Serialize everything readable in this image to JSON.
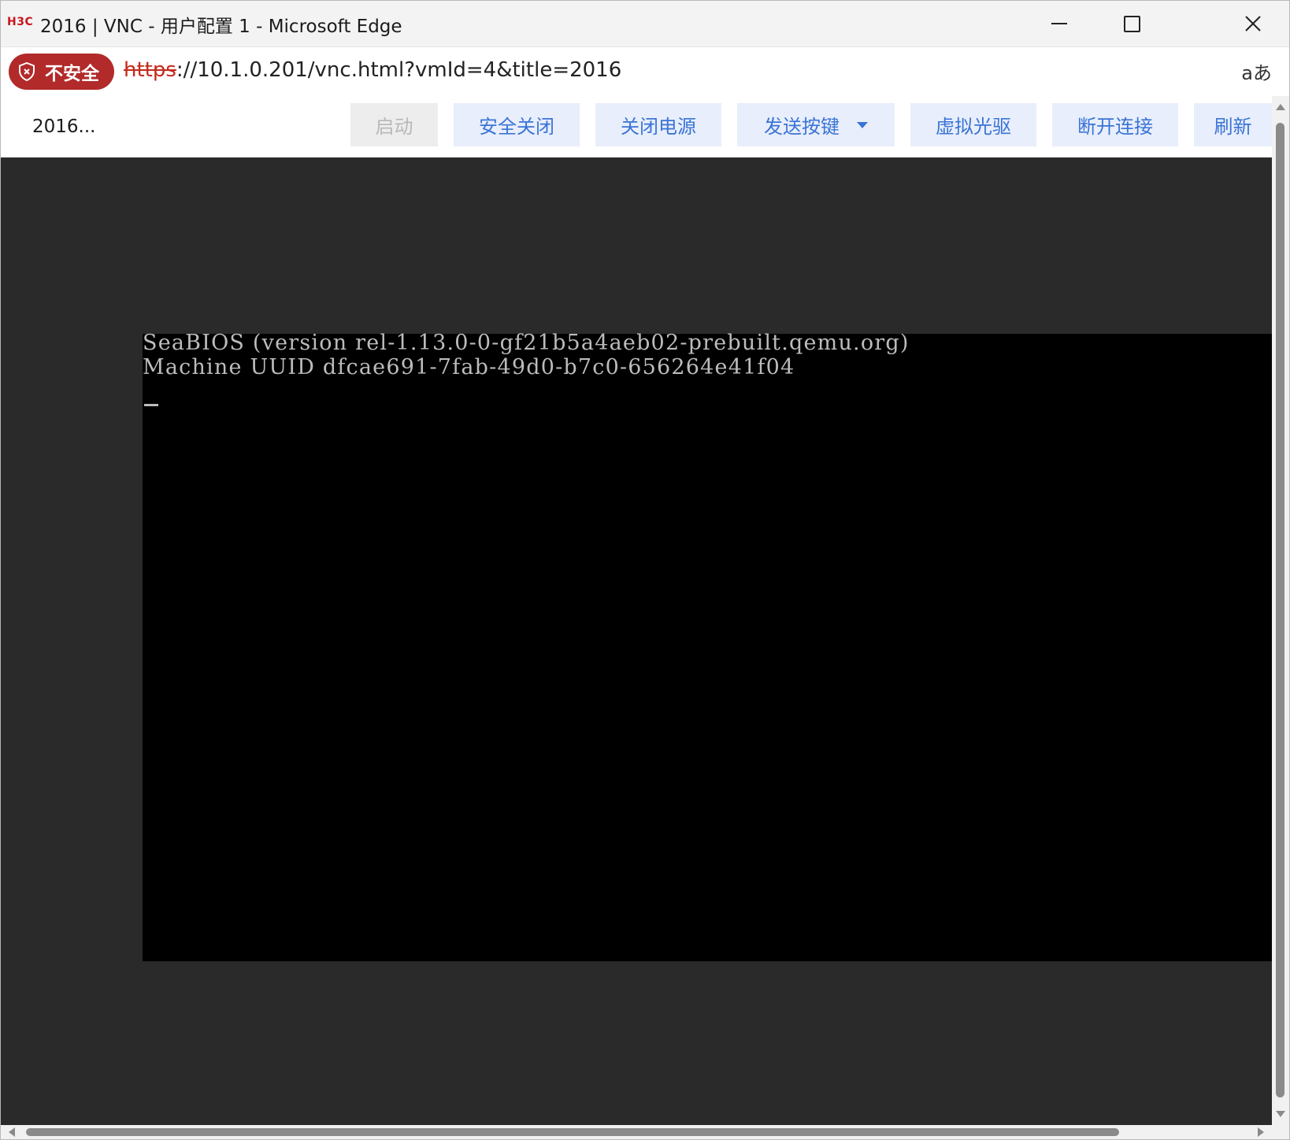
{
  "window": {
    "logo_text": "H3C",
    "title": "2016 | VNC - 用户配置 1 - Microsoft Edge",
    "controls": [
      "minimize-icon",
      "maximize-icon",
      "close-icon"
    ]
  },
  "addressbar": {
    "security_label": "不安全",
    "security_icon": "shield-alert-icon",
    "url_protocol": "https",
    "url_rest": "://10.1.0.201/vnc.html?vmId=4&title=2016",
    "translate_label": "aあ"
  },
  "toolbar": {
    "vm_name": "2016...",
    "buttons": [
      {
        "label": "启动",
        "disabled": true
      },
      {
        "label": "安全关闭"
      },
      {
        "label": "关闭电源"
      },
      {
        "label": "发送按键",
        "has_dropdown": true
      },
      {
        "label": "虚拟光驱"
      },
      {
        "label": "断开连接"
      },
      {
        "label": "刷新"
      }
    ],
    "accent_color": "#3a74d6",
    "button_bg": "#e8eefb"
  },
  "console": {
    "lines": [
      "SeaBIOS (version rel-1.13.0-0-gf21b5a4aeb02-prebuilt.qemu.org)",
      "Machine UUID dfcae691-7fab-49d0-b7c0-656264e41f04"
    ],
    "text_color": "#bcbcbc",
    "background": "#000000"
  }
}
